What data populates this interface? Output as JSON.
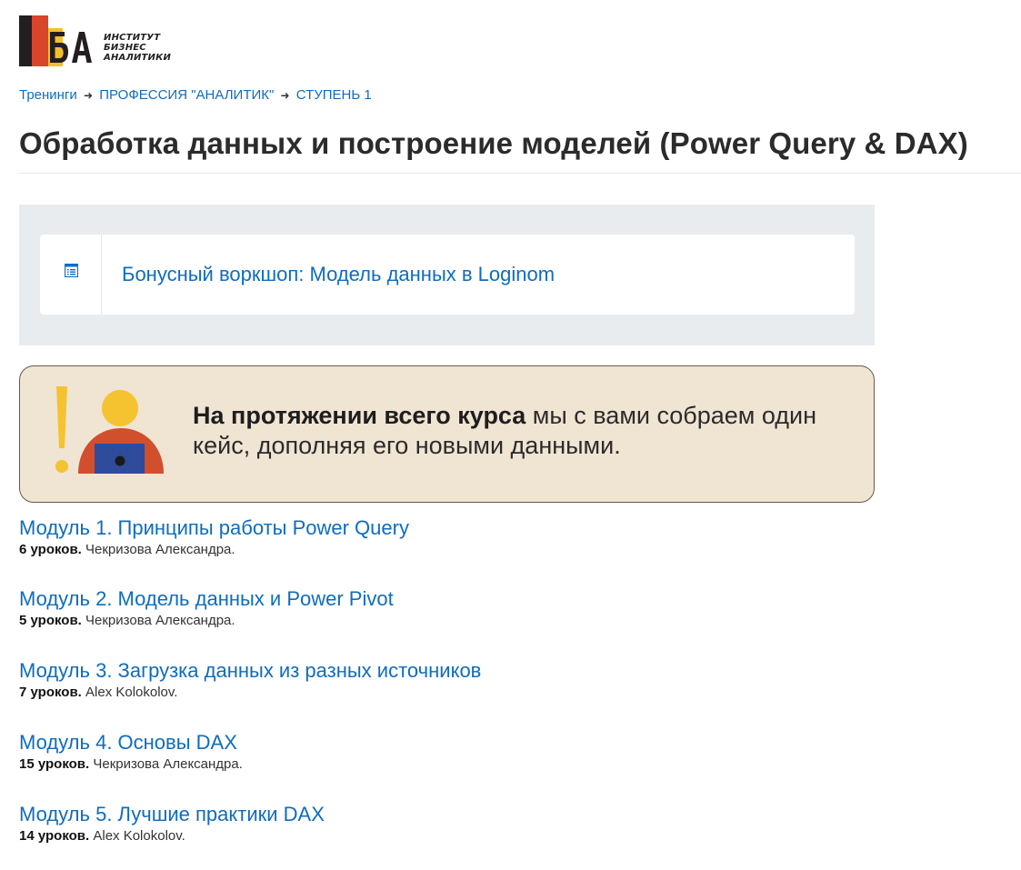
{
  "logo": {
    "lines": [
      "Институт",
      "Бизнес",
      "Аналитики"
    ],
    "colors": {
      "dark": "#231f20",
      "red": "#d9452a",
      "yellow": "#f5bf2a",
      "orange": "#e8772e"
    }
  },
  "breadcrumb": {
    "items": [
      "Тренинги",
      "ПРОФЕССИЯ \"АНАЛИТИК\"",
      "СТУПЕНЬ 1"
    ],
    "separator": "➜"
  },
  "page": {
    "title": "Обработка данных и построение моделей (Power Query & DAX)"
  },
  "bonus": {
    "icon": "list-icon",
    "label": "Бонусный воркшоп: Модель данных в Loginom"
  },
  "banner": {
    "bold_text": "На протяжении всего курса",
    "text": " мы с вами собраем один кейс, дополняя его новыми данными.",
    "colors": {
      "background": "#f0e4d3",
      "yellow": "#f5c330",
      "red": "#d14f2d",
      "blue": "#2f4b9b"
    }
  },
  "modules": [
    {
      "title": "Модуль 1. Принципы работы Power Query",
      "lessons": "6 уроков.",
      "author": "Чекризова Александра."
    },
    {
      "title": "Модуль 2. Модель данных и Power Pivot",
      "lessons": "5 уроков.",
      "author": "Чекризова Александра."
    },
    {
      "title": "Модуль 3. Загрузка данных из разных источников",
      "lessons": "7 уроков.",
      "author": "Alex Kolokolov."
    },
    {
      "title": "Модуль 4. Основы DAX",
      "lessons": "15 уроков.",
      "author": "Чекризова Александра."
    },
    {
      "title": "Модуль 5. Лучшие практики DAX",
      "lessons": "14 уроков.",
      "author": "Alex Kolokolov."
    }
  ],
  "colors": {
    "link": "#0f6cbf",
    "grey_box": "#e9ecef"
  }
}
